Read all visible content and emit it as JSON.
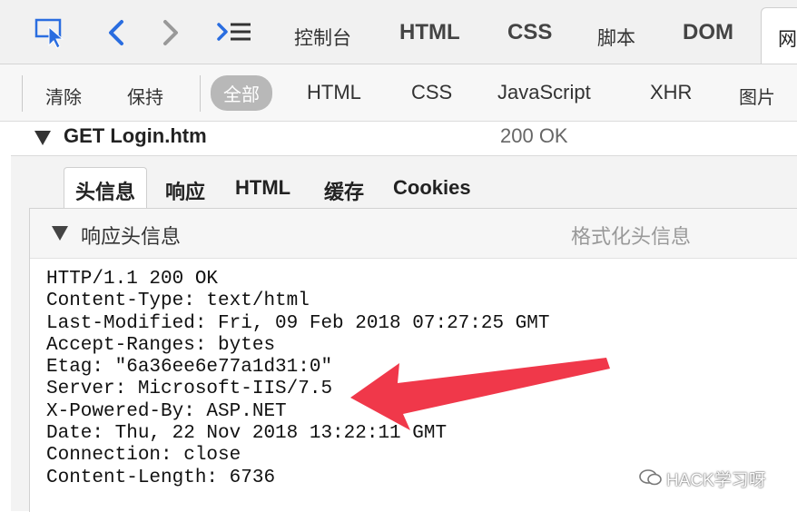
{
  "toolbar": {
    "tabs": [
      "控制台",
      "HTML",
      "CSS",
      "脚本",
      "DOM",
      "网"
    ]
  },
  "filters": {
    "clear": "清除",
    "persist": "保持",
    "items": [
      "全部",
      "HTML",
      "CSS",
      "JavaScript",
      "XHR",
      "图片"
    ]
  },
  "request": {
    "name": "GET Login.htm",
    "status": "200 OK"
  },
  "detail": {
    "tabs": [
      "头信息",
      "响应",
      "HTML",
      "缓存",
      "Cookies"
    ],
    "section_title": "响应头信息",
    "format_label": "格式化头信息",
    "headers": [
      "HTTP/1.1 200 OK",
      "Content-Type: text/html",
      "Last-Modified: Fri, 09 Feb 2018 07:27:25 GMT",
      "Accept-Ranges: bytes",
      "Etag: \"6a36ee6e77a1d31:0\"",
      "Server: Microsoft-IIS/7.5",
      "X-Powered-By: ASP.NET",
      "Date: Thu, 22 Nov 2018 13:22:11 GMT",
      "Connection: close",
      "Content-Length: 6736"
    ]
  },
  "watermark": {
    "text": "HACK学习呀"
  },
  "colors": {
    "icon_blue": "#2a6de0",
    "arrow_red": "#f0384a"
  }
}
